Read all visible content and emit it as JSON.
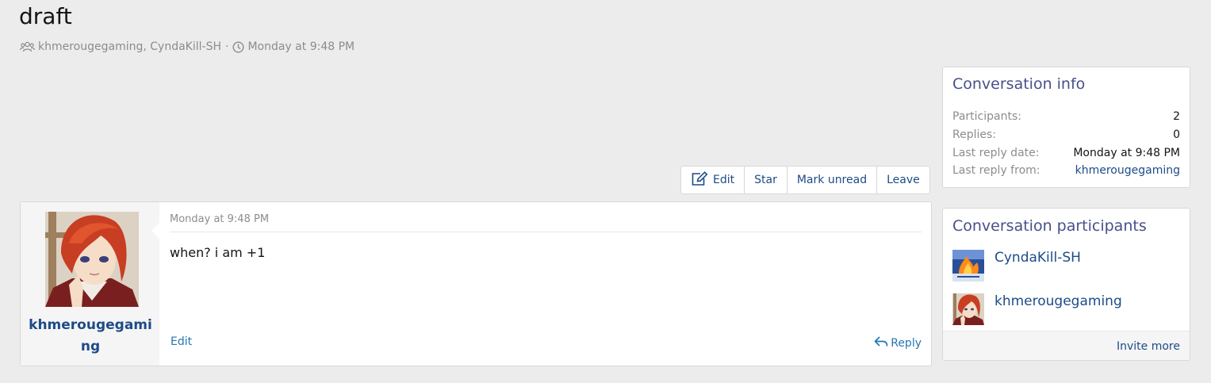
{
  "page": {
    "title": "draft",
    "participants_text": "khmerougegaming, CyndaKill-SH",
    "separator": "·",
    "date": "Monday at 9:48 PM"
  },
  "actions": {
    "edit": "Edit",
    "star": "Star",
    "mark_unread": "Mark unread",
    "leave": "Leave"
  },
  "message": {
    "username": "khmerougegaming",
    "date": "Monday at 9:48 PM",
    "body": "when? i am +1",
    "edit_label": "Edit",
    "reply_label": "Reply"
  },
  "conversation_info": {
    "title": "Conversation info",
    "rows": [
      {
        "label": "Participants:",
        "value": "2"
      },
      {
        "label": "Replies:",
        "value": "0"
      },
      {
        "label": "Last reply date:",
        "value": "Monday at 9:48 PM"
      },
      {
        "label": "Last reply from:",
        "value": "khmerougegaming"
      }
    ]
  },
  "participants": {
    "title": "Conversation participants",
    "items": [
      {
        "name": "CyndaKill-SH"
      },
      {
        "name": "khmerougegaming"
      }
    ],
    "invite_label": "Invite more"
  },
  "colors": {
    "background": "#ececec",
    "link": "#1d4b87",
    "accent_link": "#2577b1",
    "block_title": "#47508a",
    "muted": "#8c8c8c"
  },
  "icons": [
    "users-icon",
    "clock-icon",
    "edit-icon",
    "reply-icon"
  ]
}
